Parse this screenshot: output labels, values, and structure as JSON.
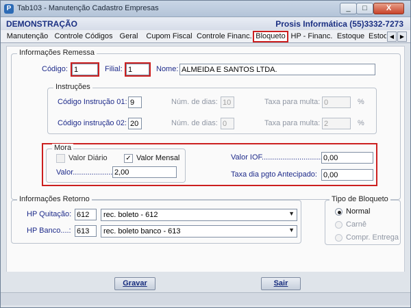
{
  "window": {
    "title": "Tab103 - Manutenção Cadastro Empresas",
    "logo_letter": "P",
    "min_glyph": "_",
    "max_glyph": "□",
    "close_glyph": "X"
  },
  "header": {
    "left": "DEMONSTRAÇÃO",
    "right": "Prosis Informática (55)3332-7273"
  },
  "tabs": [
    {
      "label": "Manutenção"
    },
    {
      "label": "Controle Códigos"
    },
    {
      "label": "Geral"
    },
    {
      "label": "Cupom Fiscal"
    },
    {
      "label": "Controle Financ."
    },
    {
      "label": "Bloqueto"
    },
    {
      "label": "HP - Financ."
    },
    {
      "label": "Estoque"
    },
    {
      "label": "Estoq"
    }
  ],
  "tab_scroll": {
    "left": "◀",
    "right": "▶"
  },
  "remessa": {
    "legend": "Informações Remessa",
    "codigo_label": "Código:",
    "codigo_value": "1",
    "filial_label": "Filial:",
    "filial_value": "1",
    "nome_label": "Nome:",
    "nome_value": "ALMEIDA E SANTOS LTDA."
  },
  "instrucoes": {
    "legend": "Instruções",
    "row1_label": "Código Instrução 01:",
    "row1_code": "9",
    "row1_dias_label": "Núm. de dias:",
    "row1_dias": "10",
    "row1_multa_label": "Taxa para multa:",
    "row1_multa": "0",
    "row2_label": "Código instrução 02:",
    "row2_code": "20",
    "row2_dias_label": "Núm. de dias:",
    "row2_dias": "0",
    "row2_multa_label": "Taxa para multa:",
    "row2_multa": "2",
    "percent": "%"
  },
  "mora": {
    "legend": "Mora",
    "valor_diario_label": "Valor Diário",
    "valor_diario_checked": false,
    "valor_mensal_label": "Valor Mensal",
    "valor_mensal_checked": true,
    "check_glyph": "✓",
    "valor_label": "Valor......................:",
    "valor_value": "2,00",
    "iof_label": "Valor IOF.............................:",
    "iof_value": "0,00",
    "taxa_label": "Taxa dia pgto Antecipado:",
    "taxa_value": "0,00"
  },
  "retorno": {
    "legend": "Informações Retorno",
    "quitacao_label": "HP Quitação:",
    "quitacao_code": "612",
    "quitacao_desc": "rec. boleto  - 612",
    "banco_label": "HP Banco....:",
    "banco_code": "613",
    "banco_desc": "rec. boleto banco - 613",
    "arrow": "▼"
  },
  "tipo": {
    "legend": "Tipo de Bloqueto",
    "options": [
      {
        "label": "Normal",
        "selected": true
      },
      {
        "label": "Carnê",
        "selected": false
      },
      {
        "label": "Compr. Entrega",
        "selected": false
      }
    ]
  },
  "footer": {
    "gravar": "Gravar",
    "sair": "Sair"
  },
  "colors": {
    "label_blue": "#1d2a8a",
    "highlight_red": "#cc1f1f",
    "header_blue": "#1a2f82"
  }
}
